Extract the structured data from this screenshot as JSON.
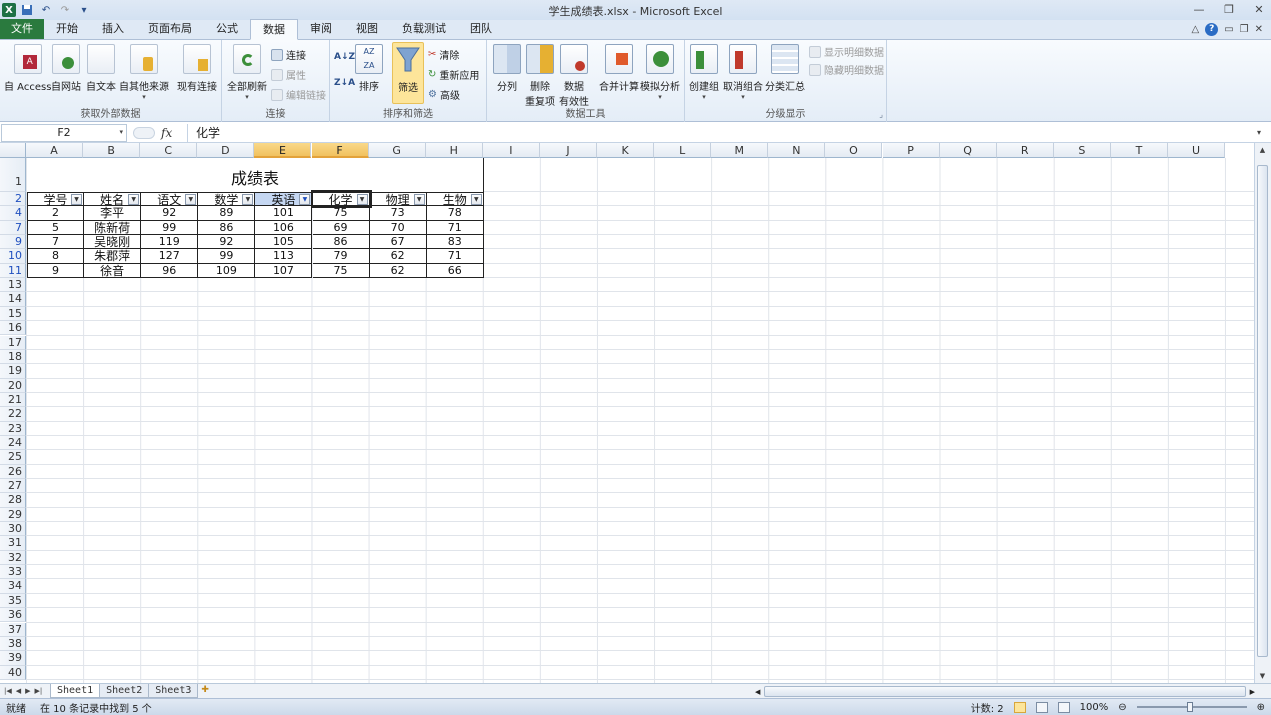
{
  "window": {
    "title": "学生成绩表.xlsx - Microsoft Excel",
    "controls": [
      "—",
      "❐",
      "✕"
    ]
  },
  "ribbon_tabs": [
    "文件",
    "开始",
    "插入",
    "页面布局",
    "公式",
    "数据",
    "审阅",
    "视图",
    "负载测试",
    "团队"
  ],
  "active_tab": "数据",
  "groups": {
    "external": {
      "label": "获取外部数据",
      "buttons": [
        "自 Access",
        "自网站",
        "自文本",
        "自其他来源",
        "现有连接"
      ]
    },
    "connections": {
      "label": "连接",
      "refresh": "全部刷新",
      "small": [
        "连接",
        "属性",
        "编辑链接"
      ]
    },
    "sort_filter": {
      "label": "排序和筛选",
      "sort": "排序",
      "filter": "筛选",
      "small": [
        "清除",
        "重新应用",
        "高级"
      ]
    },
    "data_tools": {
      "label": "数据工具",
      "buttons": [
        "分列",
        "删除\n重复项",
        "数据\n有效性",
        "合并计算",
        "模拟分析"
      ],
      "labels": {
        "split": "分列",
        "dup1": "删除",
        "dup2": "重复项",
        "valid1": "数据",
        "valid2": "有效性",
        "consolidate": "合并计算",
        "whatif": "模拟分析"
      }
    },
    "outline": {
      "label": "分级显示",
      "buttons": [
        "创建组",
        "取消组合",
        "分类汇总"
      ],
      "small": [
        "显示明细数据",
        "隐藏明细数据"
      ]
    }
  },
  "formula_bar": {
    "name_box": "F2",
    "fx": "fx",
    "formula": "化学"
  },
  "columns": [
    "A",
    "B",
    "C",
    "D",
    "E",
    "F",
    "G",
    "H",
    "I",
    "J",
    "K",
    "L",
    "M",
    "N",
    "O",
    "P",
    "Q",
    "R",
    "S",
    "T",
    "U"
  ],
  "sheet": {
    "title": "成绩表",
    "headers": [
      "学号",
      "姓名",
      "语文",
      "数学",
      "英语",
      "化学",
      "物理",
      "生物"
    ],
    "rows": [
      {
        "row": "4",
        "cells": [
          "2",
          "李平",
          "92",
          "89",
          "101",
          "75",
          "73",
          "78"
        ]
      },
      {
        "row": "7",
        "cells": [
          "5",
          "陈新荷",
          "99",
          "86",
          "106",
          "69",
          "70",
          "71"
        ]
      },
      {
        "row": "9",
        "cells": [
          "7",
          "吴晓刚",
          "119",
          "92",
          "105",
          "86",
          "67",
          "83"
        ]
      },
      {
        "row": "10",
        "cells": [
          "8",
          "朱郡萍",
          "127",
          "99",
          "113",
          "79",
          "62",
          "71"
        ]
      },
      {
        "row": "11",
        "cells": [
          "9",
          "徐音",
          "96",
          "109",
          "107",
          "75",
          "62",
          "66"
        ]
      }
    ],
    "empty_rows": [
      "13",
      "14",
      "15",
      "16",
      "17",
      "18",
      "19",
      "20",
      "21",
      "22",
      "23",
      "24",
      "25",
      "26",
      "27",
      "28",
      "29",
      "30",
      "31",
      "32",
      "33",
      "34",
      "35",
      "36",
      "37",
      "38",
      "39",
      "40"
    ]
  },
  "sheet_tabs": [
    "Sheet1",
    "Sheet2",
    "Sheet3"
  ],
  "status": {
    "ready": "就绪",
    "filter_msg": "在 10 条记录中找到 5 个",
    "count": "计数: 2",
    "zoom": "100%"
  },
  "colors": {
    "file_tab": "#2a7a3e",
    "selected_header": "#f1c15f",
    "filtered_row_number": "#1f4fbf"
  }
}
